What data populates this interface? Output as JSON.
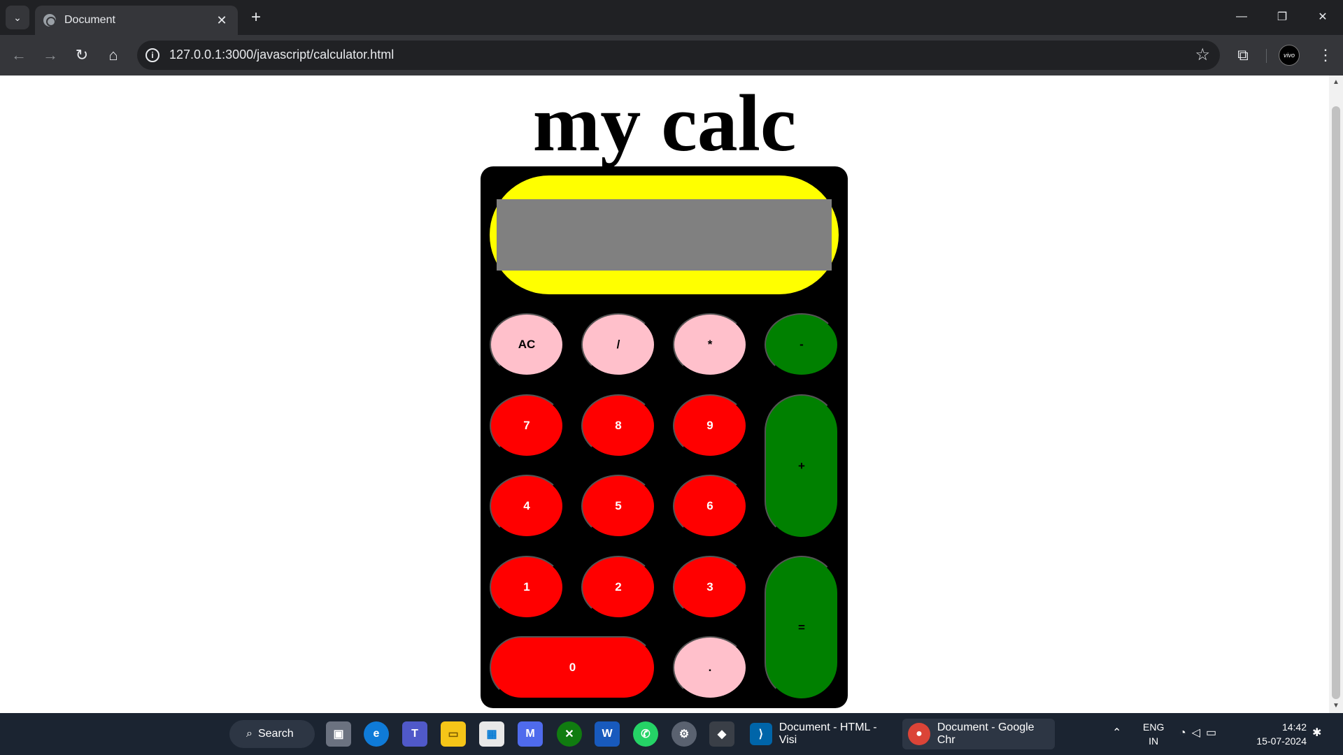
{
  "browser": {
    "tab_title": "Document",
    "url": "127.0.0.1:3000/javascript/calculator.html",
    "profile_label": "vivo"
  },
  "page": {
    "title": "my calc",
    "display_value": ""
  },
  "calculator": {
    "display_frame_color": "#ffff00",
    "display_screen_color": "#808080",
    "keys": {
      "ac": "AC",
      "divide": "/",
      "multiply": "*",
      "minus": "-",
      "seven": "7",
      "eight": "8",
      "nine": "9",
      "plus": "+",
      "four": "4",
      "five": "5",
      "six": "6",
      "one": "1",
      "two": "2",
      "three": "3",
      "equals": "=",
      "zero": "0",
      "dot": "."
    },
    "colors": {
      "operator_keys": "#ffc0cb",
      "number_keys": "#ff0000",
      "side_keys": "#008000",
      "body": "#000000"
    }
  },
  "taskbar": {
    "search_label": "Search",
    "vscode_window": "Document - HTML - Visi",
    "chrome_window": "Document - Google Chr",
    "lang_line1": "ENG",
    "lang_line2": "IN",
    "time": "14:42",
    "date": "15-07-2024"
  }
}
